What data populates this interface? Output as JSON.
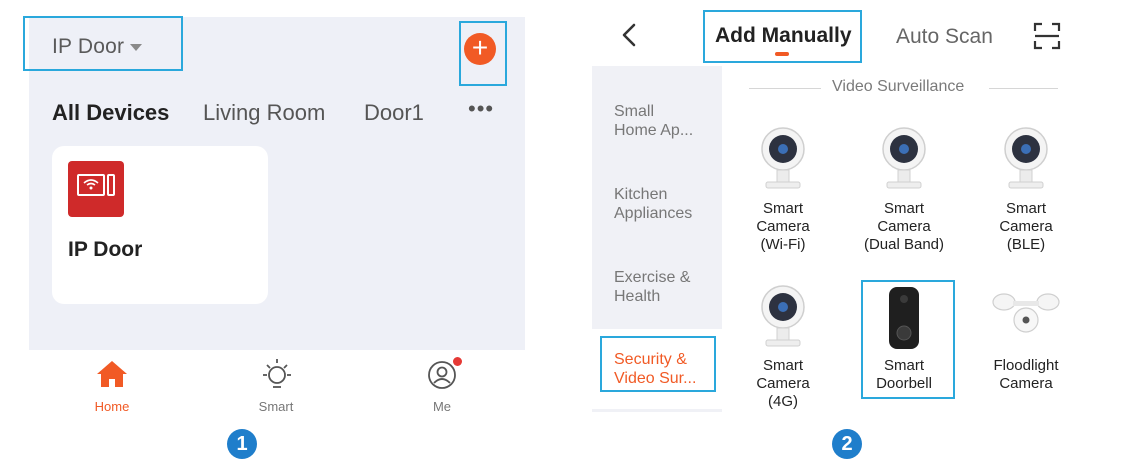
{
  "screen1": {
    "home_name": "IP Door",
    "add_button_label": "+",
    "room_tabs": [
      "All Devices",
      "Living Room",
      "Door1"
    ],
    "more_label": "•••",
    "device": {
      "name": "IP Door",
      "icon": "video-intercom-icon"
    },
    "bottom_nav": [
      {
        "label": "Home",
        "icon": "home-icon",
        "active": true
      },
      {
        "label": "Smart",
        "icon": "sun-icon",
        "active": false
      },
      {
        "label": "Me",
        "icon": "profile-icon",
        "active": false
      }
    ],
    "step": "1"
  },
  "screen2": {
    "tabs": [
      "Add Manually",
      "Auto Scan"
    ],
    "categories": [
      "Small\nHome Ap...",
      "Kitchen\nAppliances",
      "Exercise &\nHealth",
      "Security &\nVideo Sur..."
    ],
    "section_title": "Video Surveillance",
    "products": [
      {
        "label": "Smart\nCamera\n(Wi-Fi)",
        "icon": "camera-icon"
      },
      {
        "label": "Smart\nCamera\n(Dual Band)",
        "icon": "camera-icon"
      },
      {
        "label": "Smart\nCamera\n(BLE)",
        "icon": "camera-icon"
      },
      {
        "label": "Smart\nCamera\n(4G)",
        "icon": "camera-icon"
      },
      {
        "label": "Smart\nDoorbell",
        "icon": "doorbell-icon"
      },
      {
        "label": "Floodlight\nCamera",
        "icon": "floodlight-icon"
      }
    ],
    "step": "2"
  },
  "colors": {
    "accent": "#f15a25",
    "highlight_box": "#2aa8dc",
    "step_badge": "#1f7ecb",
    "device_icon": "#cf2a2a"
  }
}
